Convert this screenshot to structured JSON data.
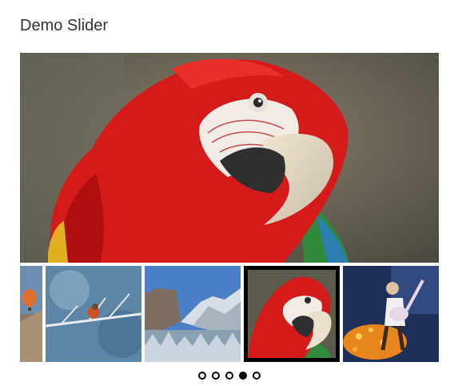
{
  "page": {
    "title": "Demo Slider"
  },
  "slider": {
    "current_index": 4,
    "slides": [
      {
        "name": "balloon-slide",
        "icon": "hot-air-balloon"
      },
      {
        "name": "robin-slide",
        "icon": "bird-on-branch"
      },
      {
        "name": "yosemite-slide",
        "icon": "snowy-mountains"
      },
      {
        "name": "macaw-slide",
        "icon": "parrot",
        "active": true
      },
      {
        "name": "coco-slide",
        "icon": "guitar-figure"
      }
    ],
    "dots": [
      {
        "active": false
      },
      {
        "active": false
      },
      {
        "active": false
      },
      {
        "active": true
      },
      {
        "active": false
      }
    ]
  },
  "colors": {
    "active_border": "#000000",
    "title": "#333333"
  }
}
